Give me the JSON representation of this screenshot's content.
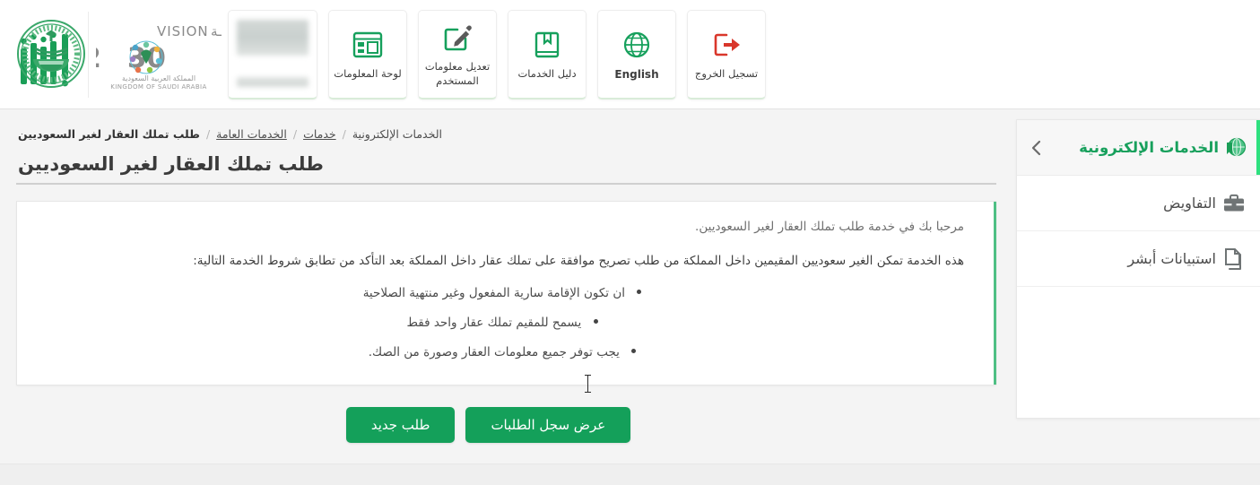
{
  "header": {
    "nav_tiles": [
      {
        "label": "لوحة المعلومات",
        "icon": "dashboard-icon"
      },
      {
        "label": "تعديل معلومات المستخدم",
        "icon": "edit-user-icon"
      },
      {
        "label": "دليل الخدمات",
        "icon": "book-icon"
      },
      {
        "label": "English",
        "icon": "globe-icon"
      },
      {
        "label": "تسجيل الخروج",
        "icon": "logout-icon"
      }
    ],
    "profile_tile": {
      "label": "",
      "state": "redacted"
    },
    "vision_logo": {
      "word_ar": "رؤيــــة",
      "word_en": "VISION",
      "year": "2030",
      "kingdom_ar": "المملكة العربية السعودية",
      "kingdom_en": "KINGDOM OF SAUDI ARABIA"
    },
    "absher_logo": {
      "alt": "أبشر"
    },
    "moi_emblem": {
      "alt": "وزارة الداخلية"
    }
  },
  "sidebar": {
    "title": "الخدمات الإلكترونية",
    "collapse_chevron": "‹",
    "items": [
      {
        "label": "التفاويض",
        "icon": "briefcase-icon"
      },
      {
        "label": "استبيانات أبشر",
        "icon": "documents-icon"
      }
    ]
  },
  "breadcrumb": [
    {
      "label": "الخدمات الإلكترونية",
      "type": "plain"
    },
    {
      "label": "خدمات",
      "type": "link"
    },
    {
      "label": "الخدمات العامة",
      "type": "link"
    },
    {
      "label": "طلب تملك العقار لغير السعوديين",
      "type": "current"
    }
  ],
  "page": {
    "title": "طلب تملك العقار لغير السعوديين",
    "intro": "مرحبا بك في خدمة طلب تملك العقار لغير السعوديين.",
    "description": "هذه الخدمة تمكن الغير سعوديين المقيمين داخل المملكة من طلب تصريح موافقة على تملك عقار داخل المملكة بعد التأكد من تطابق شروط الخدمة التالية:",
    "conditions": [
      "ان تكون الإقامة سارية المفعول وغير منتهية الصلاحية",
      "يسمح للمقيم تملك عقار واحد فقط",
      "يجب توفر جميع معلومات العقار وصورة من الصك."
    ]
  },
  "buttons": {
    "new_request": "طلب جديد",
    "view_requests": "عرض سجل الطلبات"
  },
  "colors": {
    "brand_green": "#14a05a",
    "accent_green": "#2ee07f",
    "sidebar_title_green": "#17a05c",
    "logout_red": "#d9372b",
    "card_accent": "#4fbf84"
  }
}
